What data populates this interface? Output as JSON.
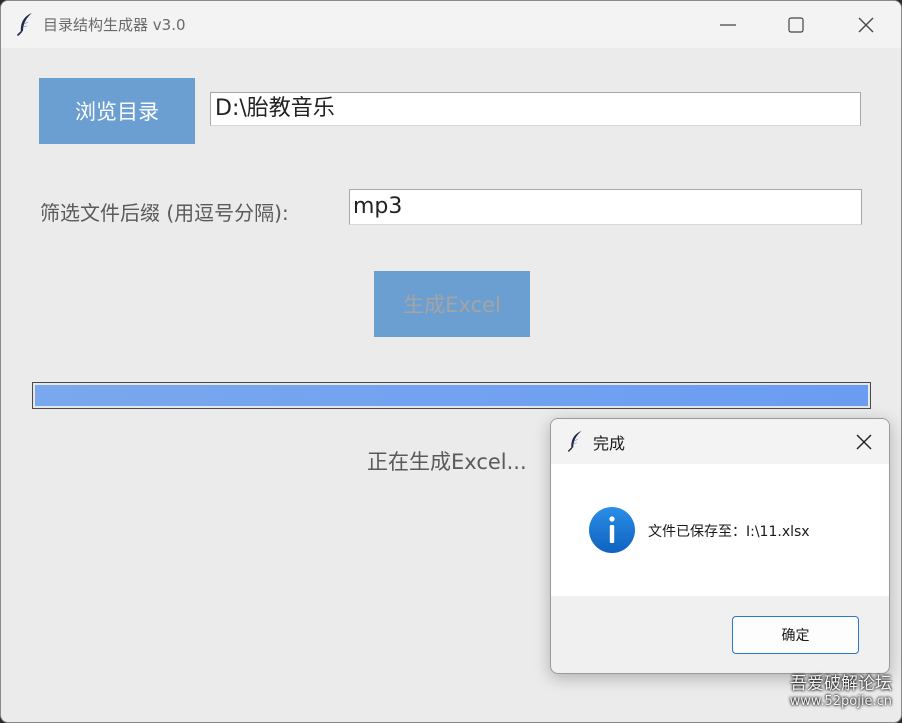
{
  "window": {
    "title": "目录结构生成器 v3.0",
    "icons": {
      "app": "feather-icon",
      "minimize": "minimize-icon",
      "maximize": "maximize-icon",
      "close": "close-icon"
    }
  },
  "main": {
    "browse_label": "浏览目录",
    "path_value": "D:\\胎教音乐",
    "filter_label": "筛选文件后缀 (用逗号分隔):",
    "filter_value": "mp3",
    "generate_label": "生成Excel",
    "progress_percent": 100,
    "status": "正在生成Excel..."
  },
  "dialog": {
    "title": "完成",
    "message": "文件已保存至：I:\\11.xlsx",
    "ok_label": "确定",
    "icons": {
      "app": "feather-icon",
      "info": "info-icon",
      "close": "close-icon"
    }
  },
  "watermark": {
    "line1": "吾爱破解论坛",
    "line2": "www.52pojie.cn"
  },
  "colors": {
    "button_bg": "#6b9ed1",
    "progress_fill": "#6a9cf2",
    "info_icon": "#1677d2",
    "ok_border": "#2a78c8"
  }
}
